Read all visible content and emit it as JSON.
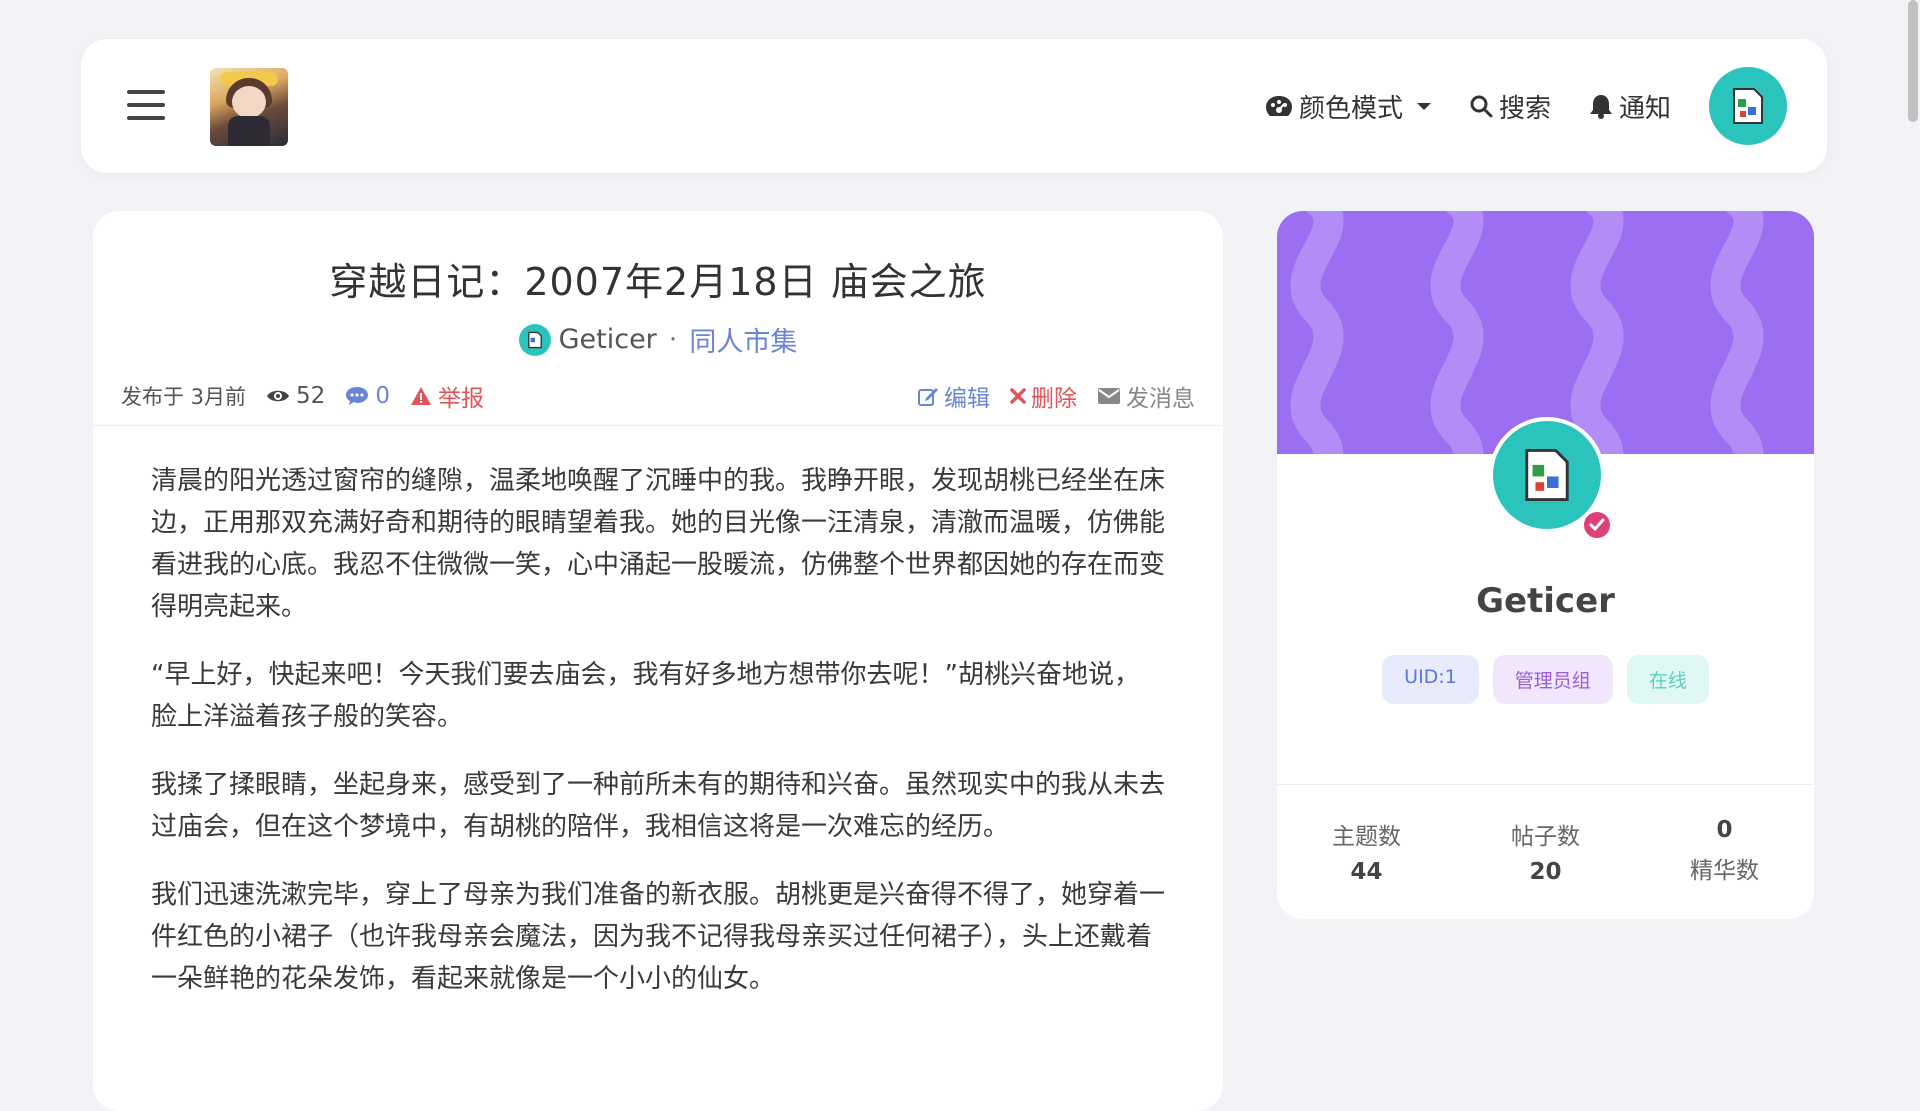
{
  "header": {
    "menu_label": "菜单",
    "color_mode": "颜色模式",
    "search": "搜索",
    "notify": "通知"
  },
  "article": {
    "title": "穿越日记：2007年2月18日 庙会之旅",
    "author": "Geticer",
    "category": "同人市集",
    "posted": "发布于 3月前",
    "views": "52",
    "comments": "0",
    "report": "举报",
    "edit": "编辑",
    "delete": "删除",
    "message": "发消息",
    "paragraphs": [
      "清晨的阳光透过窗帘的缝隙，温柔地唤醒了沉睡中的我。我睁开眼，发现胡桃已经坐在床边，正用那双充满好奇和期待的眼睛望着我。她的目光像一汪清泉，清澈而温暖，仿佛能看进我的心底。我忍不住微微一笑，心中涌起一股暖流，仿佛整个世界都因她的存在而变得明亮起来。",
      "“早上好，快起来吧！今天我们要去庙会，我有好多地方想带你去呢！”胡桃兴奋地说，脸上洋溢着孩子般的笑容。",
      "我揉了揉眼睛，坐起身来，感受到了一种前所未有的期待和兴奋。虽然现实中的我从未去过庙会，但在这个梦境中，有胡桃的陪伴，我相信这将是一次难忘的经历。",
      "我们迅速洗漱完毕，穿上了母亲为我们准备的新衣服。胡桃更是兴奋得不得了，她穿着一件红色的小裙子（也许我母亲会魔法，因为我不记得我母亲买过任何裙子），头上还戴着一朵鲜艳的花朵发饰，看起来就像是一个小小的仙女。"
    ]
  },
  "profile": {
    "name": "Geticer",
    "badges": {
      "uid": "UID:1",
      "group": "管理员组",
      "status": "在线"
    },
    "stats": {
      "topics_label": "主题数",
      "topics": "44",
      "posts_label": "帖子数",
      "posts": "20",
      "featured_label": "精华数",
      "featured": "0"
    }
  },
  "colors": {
    "accent_teal": "#2bc4bd",
    "banner_purple": "#9c6ef2",
    "link_blue": "#6a84d6",
    "danger_red": "#e0555a"
  }
}
